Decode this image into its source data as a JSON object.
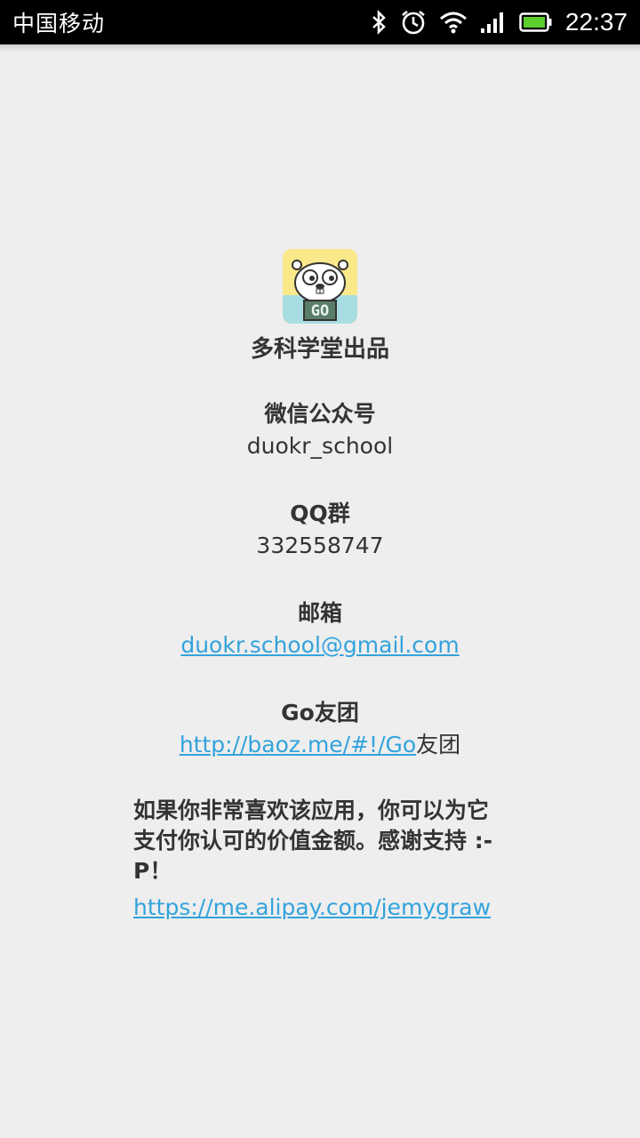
{
  "status_bar": {
    "carrier": "中国移动",
    "time": "22:37",
    "icons": [
      "bluetooth-icon",
      "alarm-icon",
      "wifi-icon",
      "signal-icon",
      "battery-icon"
    ],
    "battery_color": "#5ccf2e"
  },
  "app": {
    "icon_text": "GO",
    "brand": "多科学堂出品"
  },
  "wechat": {
    "label": "微信公众号",
    "value": "duokr_school"
  },
  "qq": {
    "label": "QQ群",
    "value": "332558747"
  },
  "email": {
    "label": "邮箱",
    "value": "duokr.school@gmail.com"
  },
  "gofriends": {
    "label": "Go友团",
    "link_text": "http://baoz.me/#!/Go",
    "suffix": "友团"
  },
  "donate": {
    "text": "如果你非常喜欢该应用，你可以为它支付你认可的价值金额。感谢支持 :-P！",
    "link": "https://me.alipay.com/jemygraw"
  },
  "colors": {
    "link": "#33a3dc",
    "background": "#eeeeee",
    "status_bar": "#000000"
  }
}
